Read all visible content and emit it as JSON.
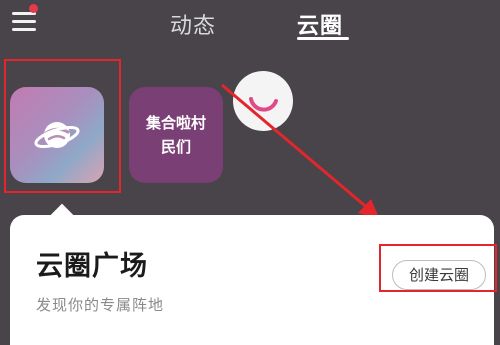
{
  "header": {
    "tabs": [
      {
        "label": "动态",
        "selected": false
      },
      {
        "label": "云圈",
        "selected": true
      }
    ],
    "menu_icon": "hamburger-menu-icon",
    "notification_dot_color": "#e6394a"
  },
  "circles": [
    {
      "name": "",
      "icon": "planet-icon"
    },
    {
      "name_line1": "集合啦村",
      "name_line2": "民们"
    }
  ],
  "loading_icon": "spinner-icon",
  "card": {
    "title": "云圈广场",
    "subtitle": "发现你的专属阵地",
    "create_label": "创建云圈"
  },
  "annotation_color": "#e3262b"
}
